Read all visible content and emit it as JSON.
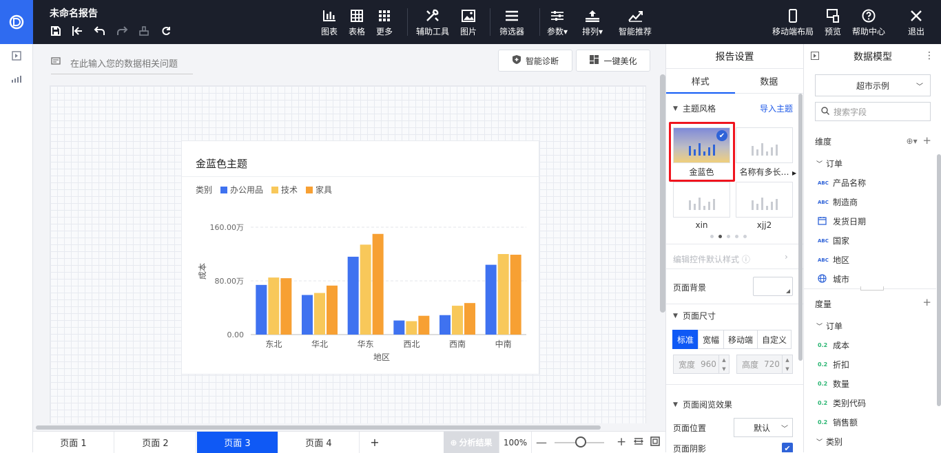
{
  "app": {
    "title": "未命名报告"
  },
  "toolbar": {
    "chart": "图表",
    "table": "表格",
    "more": "更多",
    "assist": "辅助工具",
    "image": "图片",
    "filter": "筛选器",
    "params": "参数",
    "arrange": "排列",
    "smart": "智能推荐",
    "mobile": "移动端布局",
    "preview": "预览",
    "help": "帮助中心",
    "exit": "退出"
  },
  "canvas": {
    "ask_placeholder": "在此输入您的数据相关问题",
    "diagnose": "智能诊断",
    "beautify": "一键美化"
  },
  "chart_data": {
    "type": "bar",
    "title": "金蓝色主题",
    "legend_title": "类别",
    "xlabel": "地区",
    "ylabel": "成本",
    "categories": [
      "东北",
      "华北",
      "华东",
      "西北",
      "西南",
      "中南"
    ],
    "series": [
      {
        "name": "办公用品",
        "color": "#3f72f0",
        "values": [
          740000,
          590000,
          1160000,
          210000,
          290000,
          1040000
        ]
      },
      {
        "name": "技术",
        "color": "#f8c85a",
        "values": [
          850000,
          620000,
          1340000,
          200000,
          430000,
          1200000
        ]
      },
      {
        "name": "家具",
        "color": "#f7a033",
        "values": [
          840000,
          730000,
          1500000,
          280000,
          470000,
          1190000
        ]
      }
    ],
    "yticks": [
      {
        "v": 0,
        "label": "0.00"
      },
      {
        "v": 800000,
        "label": "80.00万"
      },
      {
        "v": 1600000,
        "label": "160.00万"
      }
    ],
    "ylim": [
      0,
      1600000
    ]
  },
  "page_tabs": {
    "items": [
      "页面 1",
      "页面 2",
      "页面 3",
      "页面 4"
    ],
    "active": 2,
    "add": "+",
    "analysis": "分析结果",
    "zoom": "100%"
  },
  "settings": {
    "title": "报告设置",
    "tab_style": "样式",
    "tab_data": "数据",
    "theme_section": "主题风格",
    "import_theme": "导入主题",
    "themes": [
      "金蓝色",
      "名称有多长…",
      "xin",
      "xjj2"
    ],
    "edit_default": "编辑控件默认样式",
    "page_bg": "页面背景",
    "page_size": "页面尺寸",
    "size_options": [
      "标准",
      "宽幅",
      "移动端",
      "自定义"
    ],
    "width_label": "宽度",
    "width_value": "960",
    "height_label": "高度",
    "height_value": "720",
    "browse_effect": "页面阅览效果",
    "page_pos": "页面位置",
    "page_pos_value": "默认",
    "page_shadow": "页面阴影"
  },
  "model": {
    "title": "数据模型",
    "dataset": "超市示例",
    "search_placeholder": "搜索字段",
    "dimension": "维度",
    "measure": "度量",
    "dim_group": "订单",
    "dim_items": [
      {
        "type": "ABC",
        "label": "产品名称"
      },
      {
        "type": "ABC",
        "label": "制造商"
      },
      {
        "type": "date",
        "label": "发货日期"
      },
      {
        "type": "ABC",
        "label": "国家"
      },
      {
        "type": "ABC",
        "label": "地区"
      },
      {
        "type": "geo",
        "label": "城市"
      }
    ],
    "mea_group": "订单",
    "mea_items": [
      "成本",
      "折扣",
      "数量",
      "类别代码",
      "销售额"
    ],
    "mea_group2": "类别",
    "num_tag": "0.2"
  }
}
